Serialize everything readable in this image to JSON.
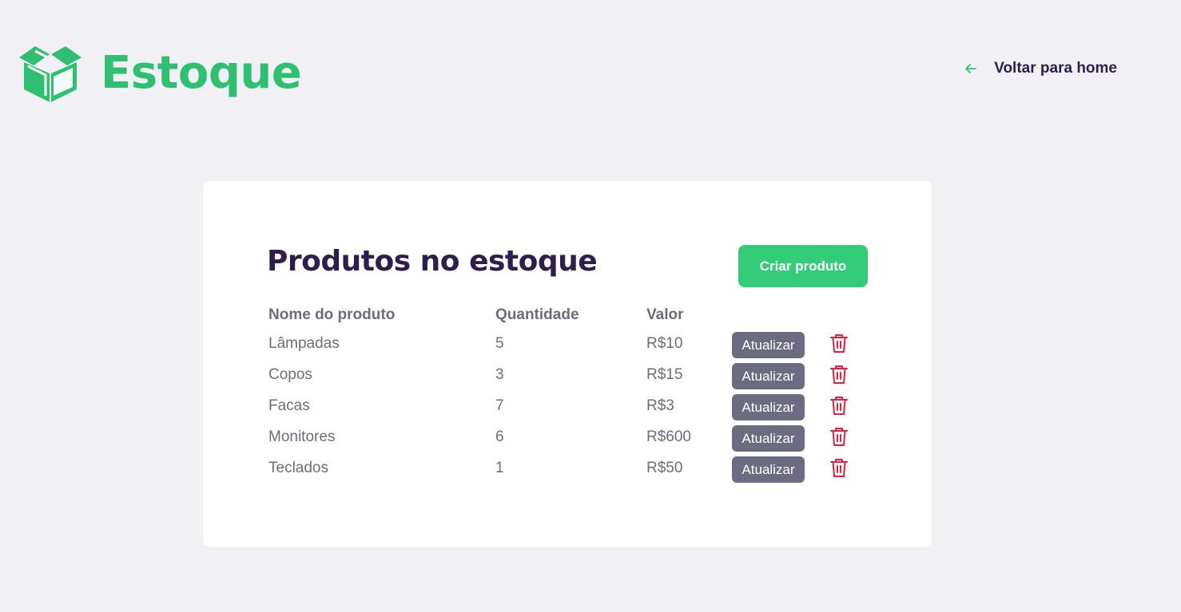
{
  "header": {
    "logo_text": "Estoque",
    "logo_icon": "open-box-icon",
    "back_link": {
      "label": "Voltar para home",
      "icon": "arrow-left-icon"
    }
  },
  "main": {
    "title": "Produtos no estoque",
    "create_button": "Criar produto",
    "table": {
      "columns": [
        "Nome do produto",
        "Quantidade",
        "Valor"
      ],
      "rows": [
        {
          "name": "Lâmpadas",
          "quantity": "5",
          "value": "R$10",
          "update_label": "Atualizar",
          "delete_icon": "trash-icon"
        },
        {
          "name": "Copos",
          "quantity": "3",
          "value": "R$15",
          "update_label": "Atualizar",
          "delete_icon": "trash-icon"
        },
        {
          "name": "Facas",
          "quantity": "7",
          "value": "R$3",
          "update_label": "Atualizar",
          "delete_icon": "trash-icon"
        },
        {
          "name": "Monitores",
          "quantity": "6",
          "value": "R$600",
          "update_label": "Atualizar",
          "delete_icon": "trash-icon"
        },
        {
          "name": "Teclados",
          "quantity": "1",
          "value": "R$50",
          "update_label": "Atualizar",
          "delete_icon": "trash-icon"
        }
      ]
    }
  },
  "colors": {
    "brand_green": "#2fbf71",
    "button_green": "#34cb79",
    "title_purple": "#2d1e4c",
    "text_gray": "#6c6c80",
    "delete_red": "#e02041",
    "background": "#f0f0f5",
    "card": "#ffffff"
  }
}
